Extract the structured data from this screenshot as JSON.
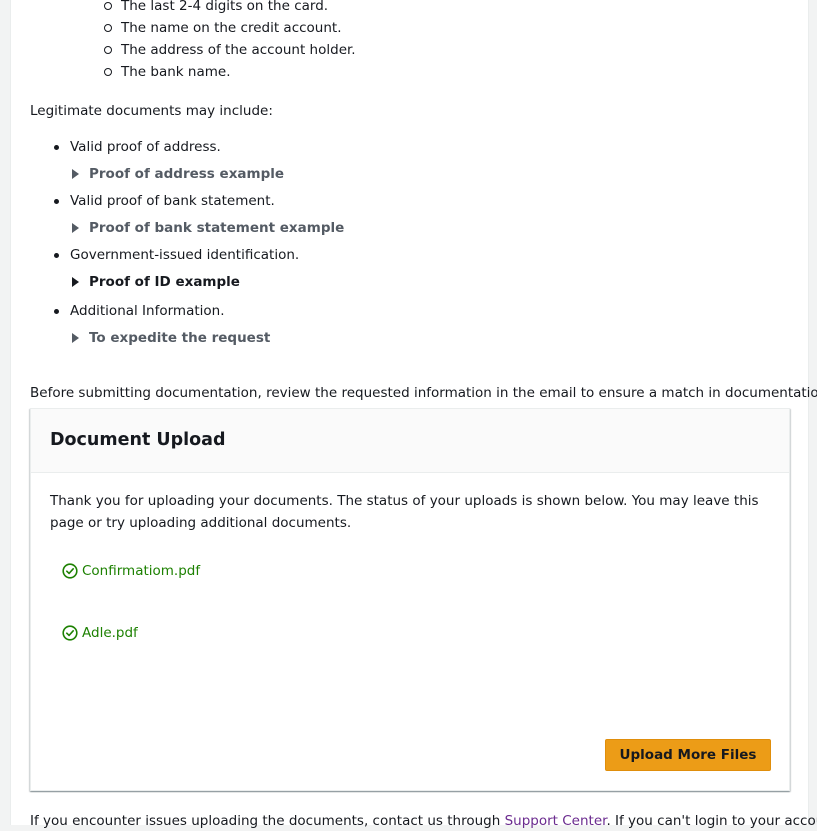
{
  "card_details": [
    "The last 2-4 digits on the card.",
    "The name on the credit account.",
    "The address of the account holder.",
    "The bank name."
  ],
  "intro_text": "Legitimate documents may include:",
  "documents": [
    {
      "label": "Valid proof of address.",
      "expander": "Proof of address example"
    },
    {
      "label": "Valid proof of bank statement.",
      "expander": "Proof of bank statement example"
    },
    {
      "label": "Government-issued identification.",
      "expander": "Proof of ID example"
    },
    {
      "label": "Additional Information.",
      "expander": "To expedite the request"
    }
  ],
  "review_text": "Before submitting documentation, review the requested information in the email to ensure a match in documentation.",
  "upload_card": {
    "title": "Document Upload",
    "message": "Thank you for uploading your documents. The status of your uploads is shown below. You may leave this page or try uploading additional documents.",
    "files": [
      "Confirmatiom.pdf",
      "Adle.pdf"
    ],
    "upload_button": "Upload More Files"
  },
  "footer": {
    "text_before": "If you encounter issues uploading the documents, contact us through ",
    "link": "Support Center",
    "text_after": ". If you can't login to your account"
  },
  "colors": {
    "success": "#1d8102",
    "button": "#ec9c17",
    "link": "#6b2b8f"
  }
}
